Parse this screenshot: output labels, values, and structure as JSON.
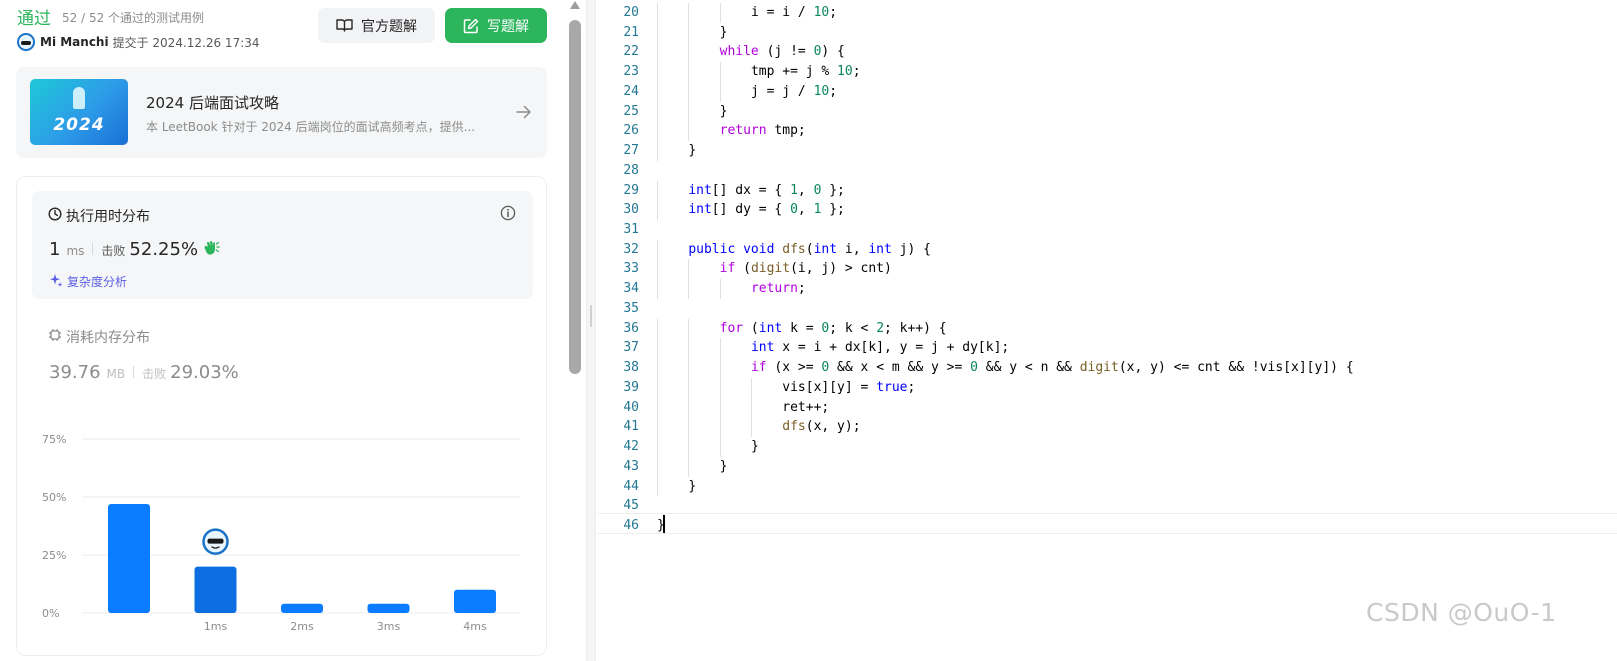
{
  "submission": {
    "status": "通过",
    "cases_text": "52 / 52 个通过的测试用例",
    "user_name": "Mi Manchi",
    "submitted_text": "提交于 2024.12.26 17:34"
  },
  "buttons": {
    "official_solution": "官方题解",
    "write_solution": "写题解"
  },
  "leetbook": {
    "cover_year": "2024",
    "title": "2024 后端面试攻略",
    "description": "本 LeetBook 针对于 2024 后端岗位的面试高频考点，提供..."
  },
  "runtime": {
    "title": "执行用时分布",
    "value": "1",
    "unit": "ms",
    "beats_label": "击败",
    "beats_pct": "52.25%",
    "complexity_link": "复杂度分析"
  },
  "memory": {
    "title": "消耗内存分布",
    "value": "39.76",
    "unit": "MB",
    "beats_label": "击败",
    "beats_pct": "29.03%"
  },
  "chart_data": {
    "type": "bar",
    "x_labels": [
      "",
      "1ms",
      "2ms",
      "3ms",
      "4ms"
    ],
    "values": [
      47,
      20,
      4,
      4,
      10
    ],
    "highlight_index": 1,
    "yticks": [
      "0%",
      "25%",
      "50%",
      "75%"
    ],
    "ylim": [
      0,
      75
    ],
    "colors": {
      "bar": "#0a7cff",
      "highlight": "#0c6ee0",
      "grid": "#eeeeee",
      "tick": "#8c8c8c"
    }
  },
  "code_lines": [
    {
      "n": "20",
      "indent": 3,
      "tokens": [
        [
          "i = i / ",
          ""
        ],
        [
          "10",
          "num"
        ],
        [
          ";",
          ""
        ]
      ]
    },
    {
      "n": "21",
      "indent": 2,
      "tokens": [
        [
          "}",
          ""
        ]
      ]
    },
    {
      "n": "22",
      "indent": 2,
      "tokens": [
        [
          "while",
          "kw"
        ],
        [
          " (j != ",
          ""
        ],
        [
          "0",
          "num"
        ],
        [
          ") {",
          ""
        ]
      ]
    },
    {
      "n": "23",
      "indent": 3,
      "tokens": [
        [
          "tmp += j % ",
          ""
        ],
        [
          "10",
          "num"
        ],
        [
          ";",
          ""
        ]
      ]
    },
    {
      "n": "24",
      "indent": 3,
      "tokens": [
        [
          "j = j / ",
          ""
        ],
        [
          "10",
          "num"
        ],
        [
          ";",
          ""
        ]
      ]
    },
    {
      "n": "25",
      "indent": 2,
      "tokens": [
        [
          "}",
          ""
        ]
      ]
    },
    {
      "n": "26",
      "indent": 2,
      "tokens": [
        [
          "return",
          "kw"
        ],
        [
          " tmp;",
          ""
        ]
      ]
    },
    {
      "n": "27",
      "indent": 1,
      "tokens": [
        [
          "}",
          ""
        ]
      ]
    },
    {
      "n": "28",
      "indent": 0,
      "tokens": []
    },
    {
      "n": "29",
      "indent": 1,
      "tokens": [
        [
          "int",
          "ty"
        ],
        [
          "[] dx = { ",
          ""
        ],
        [
          "1",
          "num"
        ],
        [
          ", ",
          ""
        ],
        [
          "0",
          "num"
        ],
        [
          " };",
          ""
        ]
      ]
    },
    {
      "n": "30",
      "indent": 1,
      "tokens": [
        [
          "int",
          "ty"
        ],
        [
          "[] dy = { ",
          ""
        ],
        [
          "0",
          "num"
        ],
        [
          ", ",
          ""
        ],
        [
          "1",
          "num"
        ],
        [
          " };",
          ""
        ]
      ]
    },
    {
      "n": "31",
      "indent": 0,
      "tokens": []
    },
    {
      "n": "32",
      "indent": 1,
      "tokens": [
        [
          "public",
          "ty"
        ],
        [
          " ",
          ""
        ],
        [
          "void",
          "ty"
        ],
        [
          " ",
          ""
        ],
        [
          "dfs",
          "fn"
        ],
        [
          "(",
          ""
        ],
        [
          "int",
          "ty"
        ],
        [
          " i, ",
          ""
        ],
        [
          "int",
          "ty"
        ],
        [
          " j) {",
          ""
        ]
      ]
    },
    {
      "n": "33",
      "indent": 2,
      "tokens": [
        [
          "if",
          "kw"
        ],
        [
          " (",
          ""
        ],
        [
          "digit",
          "fn"
        ],
        [
          "(i, j) > cnt)",
          ""
        ]
      ]
    },
    {
      "n": "34",
      "indent": 3,
      "tokens": [
        [
          "return",
          "kw"
        ],
        [
          ";",
          ""
        ]
      ]
    },
    {
      "n": "35",
      "indent": 0,
      "tokens": []
    },
    {
      "n": "36",
      "indent": 2,
      "tokens": [
        [
          "for",
          "kw"
        ],
        [
          " (",
          ""
        ],
        [
          "int",
          "ty"
        ],
        [
          " k = ",
          ""
        ],
        [
          "0",
          "num"
        ],
        [
          "; k < ",
          ""
        ],
        [
          "2",
          "num"
        ],
        [
          "; k++) {",
          ""
        ]
      ]
    },
    {
      "n": "37",
      "indent": 3,
      "tokens": [
        [
          "int",
          "ty"
        ],
        [
          " x = i + dx[k], y = j + dy[k];",
          ""
        ]
      ]
    },
    {
      "n": "38",
      "indent": 3,
      "tokens": [
        [
          "if",
          "kw"
        ],
        [
          " (x >= ",
          ""
        ],
        [
          "0",
          "num"
        ],
        [
          " && x < m && y >= ",
          ""
        ],
        [
          "0",
          "num"
        ],
        [
          " && y < n && ",
          ""
        ],
        [
          "digit",
          "fn"
        ],
        [
          "(x, y) <= cnt && !vis[x][y]) {",
          ""
        ]
      ]
    },
    {
      "n": "39",
      "indent": 4,
      "tokens": [
        [
          "vis[x][y] = ",
          ""
        ],
        [
          "true",
          "ty"
        ],
        [
          ";",
          ""
        ]
      ]
    },
    {
      "n": "40",
      "indent": 4,
      "tokens": [
        [
          "ret++;",
          ""
        ]
      ]
    },
    {
      "n": "41",
      "indent": 4,
      "tokens": [
        [
          "dfs",
          "fn"
        ],
        [
          "(x, y);",
          ""
        ]
      ]
    },
    {
      "n": "42",
      "indent": 3,
      "tokens": [
        [
          "}",
          ""
        ]
      ]
    },
    {
      "n": "43",
      "indent": 2,
      "tokens": [
        [
          "}",
          ""
        ]
      ]
    },
    {
      "n": "44",
      "indent": 1,
      "tokens": [
        [
          "}",
          ""
        ]
      ]
    },
    {
      "n": "45",
      "indent": 0,
      "tokens": []
    },
    {
      "n": "46",
      "indent": 0,
      "tokens": [
        [
          "}",
          ""
        ]
      ]
    }
  ],
  "watermark": "CSDN @OuO-1"
}
